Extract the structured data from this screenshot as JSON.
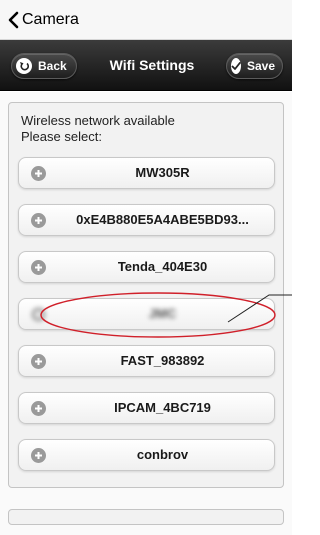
{
  "topbar": {
    "back_label": "Camera"
  },
  "header": {
    "title": "Wifi Settings",
    "back_label": "Back",
    "save_label": "Save"
  },
  "content": {
    "prompt_line1": "Wireless network available",
    "prompt_line2": "Please select:",
    "networks": [
      {
        "name": "MW305R"
      },
      {
        "name": "0xE4B880E5A4ABE5BD93..."
      },
      {
        "name": "Tenda_404E30"
      },
      {
        "name": "JMC",
        "obscured": true
      },
      {
        "name": "FAST_983892"
      },
      {
        "name": "IPCAM_4BC719"
      },
      {
        "name": "conbrov"
      }
    ]
  },
  "colors": {
    "header": "#1e1e1e",
    "annotation": "#d0202a"
  },
  "icons": [
    "chevron-left-icon",
    "back-arrow-icon",
    "checkmark-icon",
    "plus-icon"
  ]
}
